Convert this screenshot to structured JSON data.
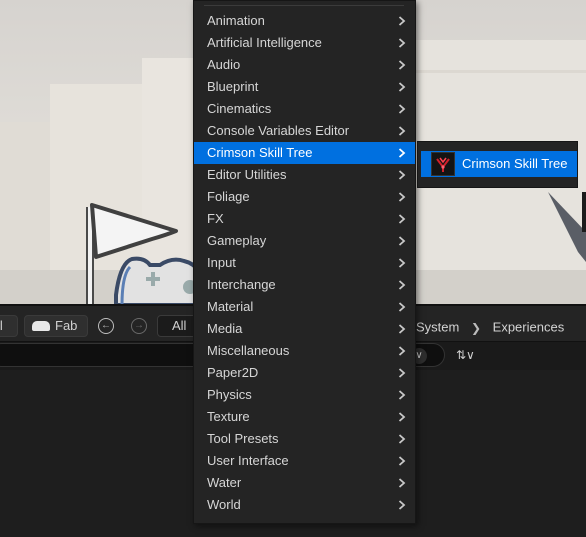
{
  "menu": {
    "items": [
      {
        "label": "Animation"
      },
      {
        "label": "Artificial Intelligence"
      },
      {
        "label": "Audio"
      },
      {
        "label": "Blueprint"
      },
      {
        "label": "Cinematics"
      },
      {
        "label": "Console Variables Editor"
      },
      {
        "label": "Crimson Skill Tree",
        "highlighted": true
      },
      {
        "label": "Editor Utilities"
      },
      {
        "label": "Foliage"
      },
      {
        "label": "FX"
      },
      {
        "label": "Gameplay"
      },
      {
        "label": "Input"
      },
      {
        "label": "Interchange"
      },
      {
        "label": "Material"
      },
      {
        "label": "Media"
      },
      {
        "label": "Miscellaneous"
      },
      {
        "label": "Paper2D"
      },
      {
        "label": "Physics"
      },
      {
        "label": "Texture"
      },
      {
        "label": "Tool Presets"
      },
      {
        "label": "User Interface"
      },
      {
        "label": "Water"
      },
      {
        "label": "World"
      }
    ],
    "submenu_icon": "chevron-right-icon"
  },
  "submenu": {
    "item_label": "Crimson Skill Tree",
    "item_icon": "crimson-skill-tree-icon"
  },
  "toolbar": {
    "all_left_label": "ll",
    "fab_label": "Fab",
    "all_path_label": "All",
    "breadcrumb": [
      "System",
      "Experiences"
    ]
  },
  "colors": {
    "highlight": "#0070e0",
    "menu_background": "#242424",
    "menu_text": "#d6d6d6"
  }
}
